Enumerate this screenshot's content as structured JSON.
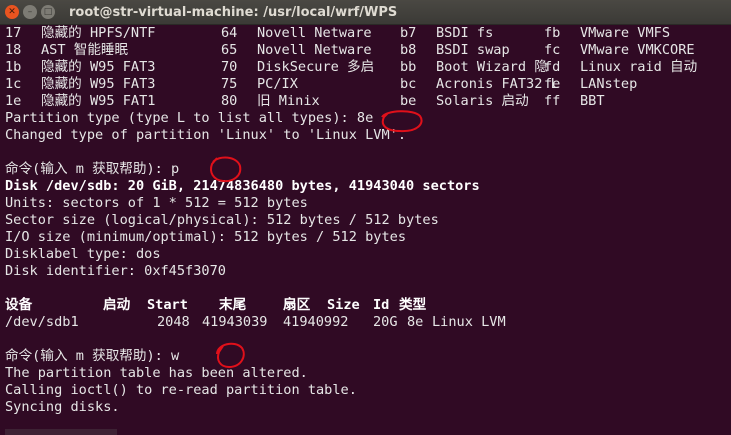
{
  "window": {
    "title": "root@str-virtual-machine: /usr/local/wrf/WPS",
    "close_glyph": "✕",
    "minimize_glyph": "–",
    "maximize_glyph": "□"
  },
  "partition_table": [
    [
      "17",
      "隐藏的 HPFS/NTF",
      "64",
      "Novell Netware",
      "b7",
      "BSDI fs",
      "fb",
      "VMware VMFS"
    ],
    [
      "18",
      "AST 智能睡眠",
      "65",
      "Novell Netware",
      "b8",
      "BSDI swap",
      "fc",
      "VMware VMKCORE"
    ],
    [
      "1b",
      "隐藏的 W95 FAT3",
      "70",
      "DiskSecure 多启",
      "bb",
      "Boot Wizard 隐",
      "fd",
      "Linux raid 自动"
    ],
    [
      "1c",
      "隐藏的 W95 FAT3",
      "75",
      "PC/IX",
      "bc",
      "Acronis FAT32 L",
      "fe",
      "LANstep"
    ],
    [
      "1e",
      "隐藏的 W95 FAT1",
      "80",
      "旧 Minix",
      "be",
      "Solaris 启动",
      "ff",
      "BBT"
    ]
  ],
  "session": {
    "type_prompt": "Partition type (type L to list all types): ",
    "type_input": "8e",
    "changed_msg": "Changed type of partition 'Linux' to 'Linux LVM'.",
    "cmd_prompt": "命令(输入 m 获取帮助): ",
    "cmd_input_p": "p",
    "disk_line": "Disk /dev/sdb: 20 GiB, 21474836480 bytes, 41943040 sectors",
    "units_line": "Units: sectors of 1 * 512 = 512 bytes",
    "sector_line": "Sector size (logical/physical): 512 bytes / 512 bytes",
    "io_line": "I/O size (minimum/optimal): 512 bytes / 512 bytes",
    "label_line": "Disklabel type: dos",
    "id_line": "Disk identifier: 0xf45f3070",
    "cmd_input_w": "w",
    "altered_msg": "The partition table has been altered.",
    "ioctl_msg": "Calling ioctl() to re-read partition table.",
    "sync_msg": "Syncing disks."
  },
  "device_table": {
    "headers": [
      "设备",
      "启动",
      "Start",
      "末尾",
      "扇区",
      "Size",
      "Id",
      "类型"
    ],
    "rows": [
      [
        "/dev/sdb1",
        "",
        "2048",
        "41943039",
        "41940992",
        "20G",
        "8e",
        "Linux LVM"
      ]
    ]
  },
  "annotation_color": "#e0101a"
}
